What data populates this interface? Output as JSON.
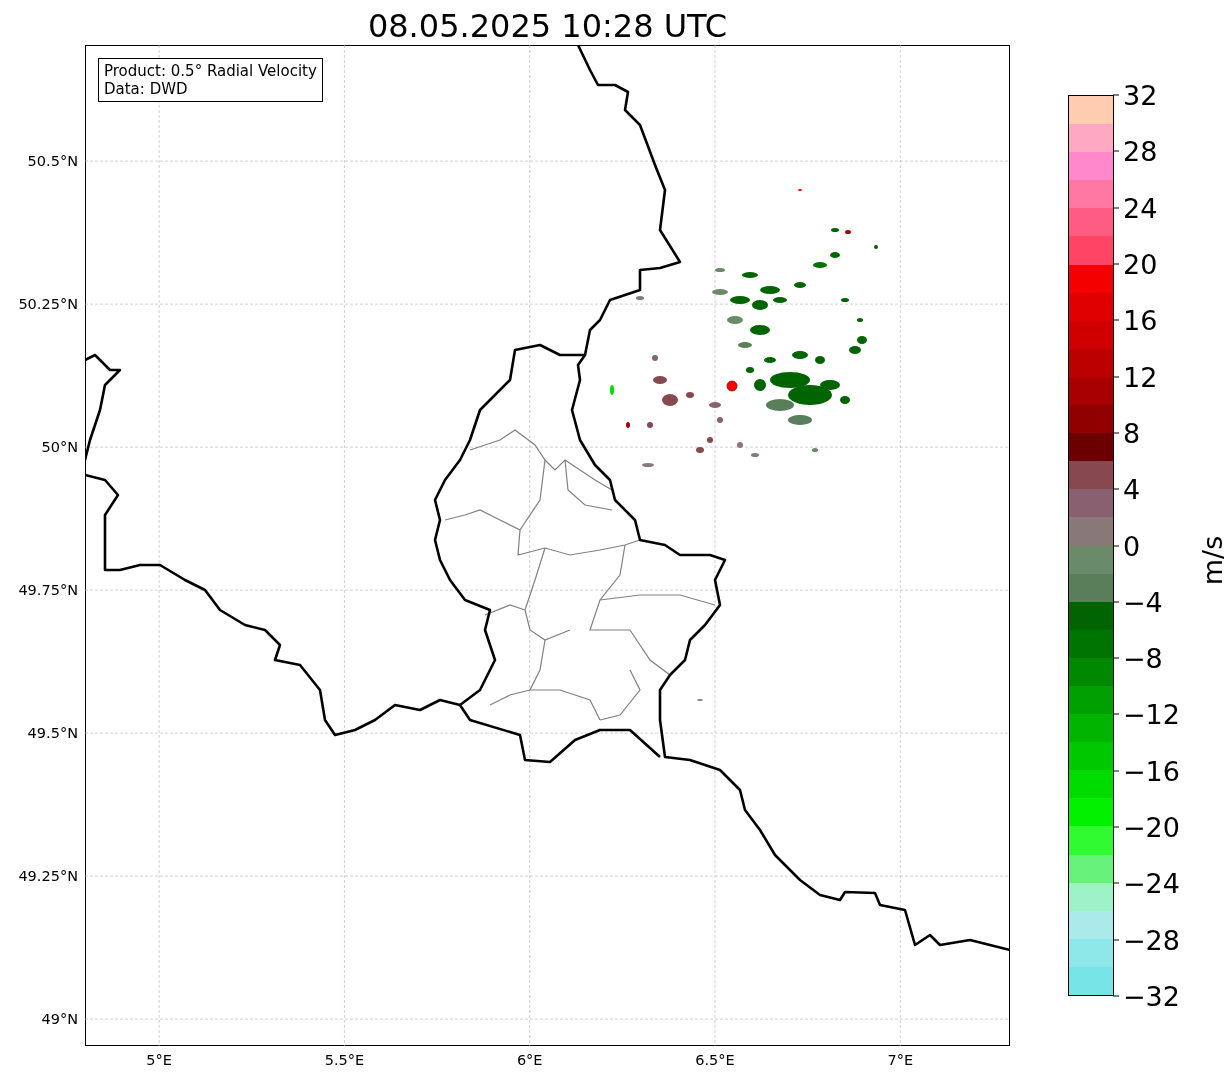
{
  "title": "08.05.2025 10:28 UTC",
  "map": {
    "legend": [
      "Product: 0.5° Radial Velocity",
      "Data: DWD"
    ],
    "xticks": [
      "5°E",
      "5.5°E",
      "6°E",
      "6.5°E",
      "7°E"
    ],
    "yticks": [
      "50.5°N",
      "50.25°N",
      "50°N",
      "49.75°N",
      "49.5°N",
      "49.25°N",
      "49°N"
    ]
  },
  "colorbar": {
    "label": "m/s",
    "ticks": [
      "32",
      "28",
      "24",
      "20",
      "16",
      "12",
      "8",
      "4",
      "0",
      "−4",
      "−8",
      "−12",
      "−16",
      "−20",
      "−24",
      "−28",
      "−32"
    ],
    "bins": [
      {
        "color": "#ffccb0"
      },
      {
        "color": "#ffa8c4"
      },
      {
        "color": "#ff88cc"
      },
      {
        "color": "#ff78a4"
      },
      {
        "color": "#ff5c84"
      },
      {
        "color": "#ff4466"
      },
      {
        "color": "#f50000"
      },
      {
        "color": "#e00000"
      },
      {
        "color": "#d00000"
      },
      {
        "color": "#bc0000"
      },
      {
        "color": "#a80000"
      },
      {
        "color": "#900000"
      },
      {
        "color": "#6c0000"
      },
      {
        "color": "#884850"
      },
      {
        "color": "#886070"
      },
      {
        "color": "#887878"
      },
      {
        "color": "#6a8a6a"
      },
      {
        "color": "#5a7e5a"
      },
      {
        "color": "#006400"
      },
      {
        "color": "#007400"
      },
      {
        "color": "#008800"
      },
      {
        "color": "#00a000"
      },
      {
        "color": "#00b400"
      },
      {
        "color": "#00c800"
      },
      {
        "color": "#00dc00"
      },
      {
        "color": "#00f000"
      },
      {
        "color": "#30fa30"
      },
      {
        "color": "#66f27a"
      },
      {
        "color": "#9ef2c8"
      },
      {
        "color": "#aaeaea"
      },
      {
        "color": "#8ee8ea"
      },
      {
        "color": "#76e3e6"
      }
    ]
  }
}
